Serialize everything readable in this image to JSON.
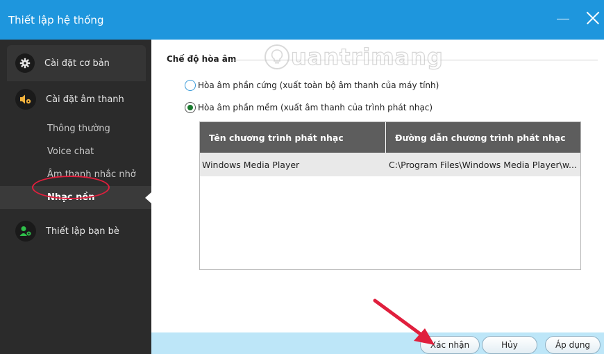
{
  "window": {
    "title": "Thiết lập hệ thống"
  },
  "sidebar": {
    "groups": [
      {
        "label": "Cài đặt cơ bản",
        "icon": "gear-icon"
      },
      {
        "label": "Cài đặt âm thanh",
        "icon": "speaker-settings-icon",
        "items": [
          "Thông thường",
          "Voice chat",
          "Âm thanh nhắc nhở",
          "Nhạc nền"
        ]
      },
      {
        "label": "Thiết lập bạn bè",
        "icon": "user-settings-icon"
      }
    ],
    "active_item": "Nhạc nền"
  },
  "watermark": {
    "brand": "uantrimang"
  },
  "main": {
    "section_title": "Chế độ hòa âm",
    "options": [
      {
        "label": "Hòa âm phần cứng (xuất toàn bộ âm thanh của máy tính)",
        "checked": false
      },
      {
        "label": "Hòa âm phần mềm (xuất âm thanh của trình phát nhạc)",
        "checked": true
      }
    ],
    "table": {
      "headers": [
        "Tên chương trình phát nhạc",
        "Đường dẫn chương trình phát nhạc"
      ],
      "rows": [
        [
          "Windows Media Player",
          "C:\\Program Files\\Windows Media Player\\w..."
        ]
      ]
    }
  },
  "footer": {
    "confirm_label": "Xác nhận",
    "cancel_label": "Hủy",
    "apply_label": "Áp dụng"
  },
  "colors": {
    "titlebar": "#1e96dd",
    "sidebar": "#2b2b2b",
    "footer": "#bde6f8",
    "accent_icon": "#f3b33d",
    "annotation": "#e01f3d"
  }
}
